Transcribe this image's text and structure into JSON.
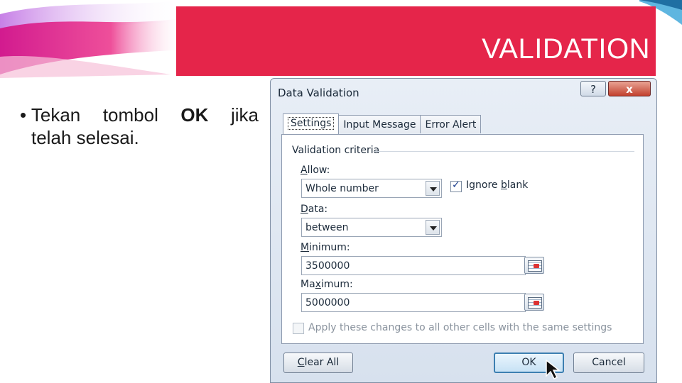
{
  "slide": {
    "title": "VALIDATION",
    "bullet": {
      "marker": "•",
      "word1": "Tekan",
      "word2": "tombol",
      "word3_bold": "OK",
      "word4": "jika",
      "line2": "telah selesai."
    }
  },
  "dialog": {
    "title": "Data Validation",
    "help_label": "?",
    "close_label": "x",
    "tabs": [
      "Settings",
      "Input Message",
      "Error Alert"
    ],
    "active_tab": "Settings",
    "group_label": "Validation criteria",
    "allow": {
      "label_prefix": "",
      "label_mnemonic": "A",
      "label_rest": "llow:",
      "value": "Whole number"
    },
    "ignore_blank": {
      "label_prefix": "Ignore ",
      "label_mnemonic": "b",
      "label_rest": "lank",
      "checked": true
    },
    "data": {
      "label_prefix": "",
      "label_mnemonic": "D",
      "label_rest": "ata:",
      "value": "between"
    },
    "minimum": {
      "label_prefix": "",
      "label_mnemonic": "M",
      "label_rest": "inimum:",
      "value": "3500000"
    },
    "maximum": {
      "label_prefix": "Ma",
      "label_mnemonic": "x",
      "label_rest": "imum:",
      "value": "5000000"
    },
    "apply_all": {
      "label": "Apply these changes to all other cells with the same settings",
      "checked": false,
      "enabled": false
    },
    "buttons": {
      "clear_all_mnemonic": "C",
      "clear_all_rest": "lear All",
      "ok": "OK",
      "cancel": "Cancel"
    }
  },
  "colors": {
    "title_banner": "#e5254a",
    "title_text": "#ffffff",
    "dialog_bg": "#dde6f1",
    "ok_focus_border": "#3c7fb1"
  },
  "icons": [
    "help-icon",
    "close-icon",
    "dropdown-arrow-icon",
    "range-selector-icon",
    "checkmark-icon",
    "mouse-cursor-icon"
  ]
}
